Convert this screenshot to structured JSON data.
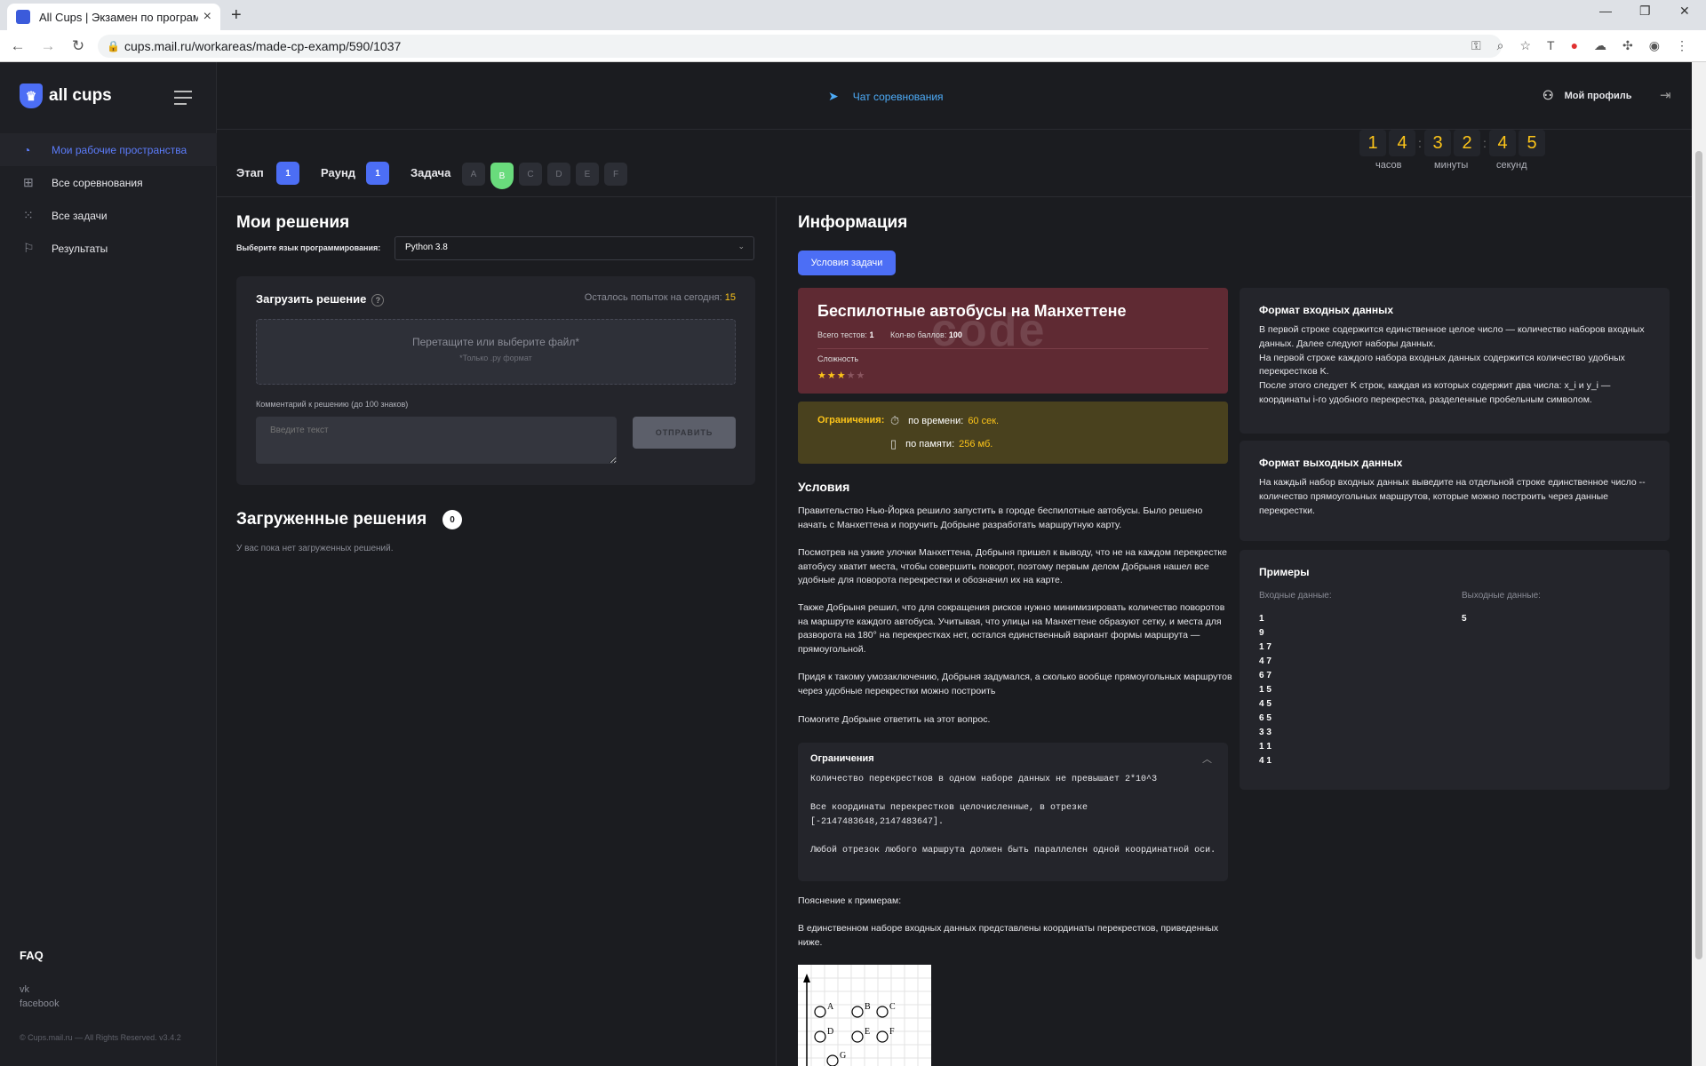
{
  "browser": {
    "tab_title": "All Cups | Экзамен по программ",
    "url": "cups.mail.ru/workareas/made-cp-examp/590/1037"
  },
  "sidebar": {
    "logo": "all cups",
    "items": [
      {
        "label": "Мои рабочие пространства",
        "icon": "pie-chart-icon",
        "active": true
      },
      {
        "label": "Все соревнования",
        "icon": "grid-icon",
        "active": false
      },
      {
        "label": "Все задачи",
        "icon": "dots-icon",
        "active": false
      },
      {
        "label": "Результаты",
        "icon": "flag-icon",
        "active": false
      }
    ],
    "faq": "FAQ",
    "links": [
      "vk",
      "facebook"
    ],
    "copyright": "© Cups.mail.ru — All Rights Reserved. v3.4.2"
  },
  "header": {
    "chat": "Чат соревнования",
    "profile": "Мой профиль"
  },
  "stage_row": {
    "stage_label": "Этап",
    "stage_value": "1",
    "round_label": "Раунд",
    "round_value": "1",
    "task_label": "Задача",
    "tasks": [
      "A",
      "B",
      "C",
      "D",
      "E",
      "F"
    ],
    "active_task": "B",
    "timer": {
      "hours": [
        "1",
        "4"
      ],
      "minutes": [
        "3",
        "2"
      ],
      "seconds": [
        "4",
        "5"
      ],
      "hours_label": "часов",
      "minutes_label": "минуты",
      "seconds_label": "секунд"
    }
  },
  "solutions": {
    "title": "Мои решения",
    "lang_label": "Выберите язык программирования:",
    "lang_value": "Python 3.8",
    "upload_title": "Загрузить решение",
    "attempts_label": "Осталось попыток на сегодня:",
    "attempts_value": "15",
    "dropzone_main": "Перетащите или выберите файл*",
    "dropzone_sub": "*Только .py формат",
    "comment_label": "Комментарий к решению (до 100 знаков)",
    "comment_placeholder": "Введите текст",
    "send": "ОТПРАВИТЬ",
    "uploaded_title": "Загруженные решения",
    "uploaded_count": "0",
    "empty": "У вас пока нет загруженных решений."
  },
  "info": {
    "title": "Информация",
    "conditions_button": "Условия задачи",
    "task_title": "Беспилотные автобусы на Манхеттене",
    "tests_label": "Всего тестов:",
    "tests_value": "1",
    "points_label": "Кол-во баллов:",
    "points_value": "100",
    "difficulty_label": "Сложность",
    "difficulty_stars": 3,
    "difficulty_max": 5,
    "limits_label": "Ограничения:",
    "time_label": "по времени:",
    "time_value": "60 сек.",
    "memory_label": "по памяти:",
    "memory_value": "256 мб.",
    "conditions_title": "Условия",
    "paragraphs": [
      "Правительство Нью-Йорка решило запустить в городе беспилотные автобусы. Было решено начать с Манхеттена и поручить Добрыне разработать маршрутную карту.",
      "Посмотрев на узкие улочки Манхеттена, Добрыня пришел к выводу, что не на каждом перекрестке автобусу хватит места, чтобы совершить поворот, поэтому первым делом Добрыня нашел все удобные для поворота перекрестки и обозначил их на карте.",
      "Также Добрыня решил, что для сокращения рисков нужно минимизировать количество поворотов на маршруте каждого автобуса. Учитывая, что улицы на Манхеттене образуют сетку, и места для разворота на 180° на перекрестках нет, остался единственный вариант формы маршрута — прямоугольной.",
      "Придя к такому умозаключению, Добрыня задумался, а сколько вообще прямоугольных маршрутов через удобные перекрестки можно построить",
      "Помогите Добрыне ответить на этот вопрос."
    ],
    "constraints_title": "Ограничения",
    "constraints": [
      "Количество перекрестков в одном наборе данных не превышает 2*10^3",
      "Все координаты перекрестков целочисленные, в отрезке [-2147483648,2147483647].",
      "Любой отрезок любого маршрута должен быть параллелен одной координатной оси."
    ],
    "explain_title": "Пояснение к примерам:",
    "explain_text": "В единственном наборе входных данных представлены координаты перекрестков, приведенных ниже.",
    "image_labels": [
      "A",
      "B",
      "C",
      "D",
      "E",
      "F",
      "G"
    ]
  },
  "input_format": {
    "title": "Формат входных данных",
    "lines": [
      "В первой строке содержится единственное целое число — количество наборов входных данных. Далее следуют наборы данных.",
      "На первой строке каждого набора входных данных содержится количество удобных перекрестков K.",
      "После этого следует K строк, каждая из которых содержит два числа: x_i и y_i — координаты i-го удобного перекрестка, разделенные пробельным символом."
    ]
  },
  "output_format": {
    "title": "Формат выходных данных",
    "text": "На каждый набор входных данных выведите на отдельной строке единственное число -- количество прямоугольных маршрутов, которые можно построить через данные перекрестки."
  },
  "examples": {
    "title": "Примеры",
    "input_label": "Входные данные:",
    "output_label": "Выходные данные:",
    "input": [
      "1",
      "9",
      "1 7",
      "4 7",
      "6 7",
      "1 5",
      "4 5",
      "6 5",
      "3 3",
      "1 1",
      "4 1"
    ],
    "output": [
      "5"
    ]
  }
}
